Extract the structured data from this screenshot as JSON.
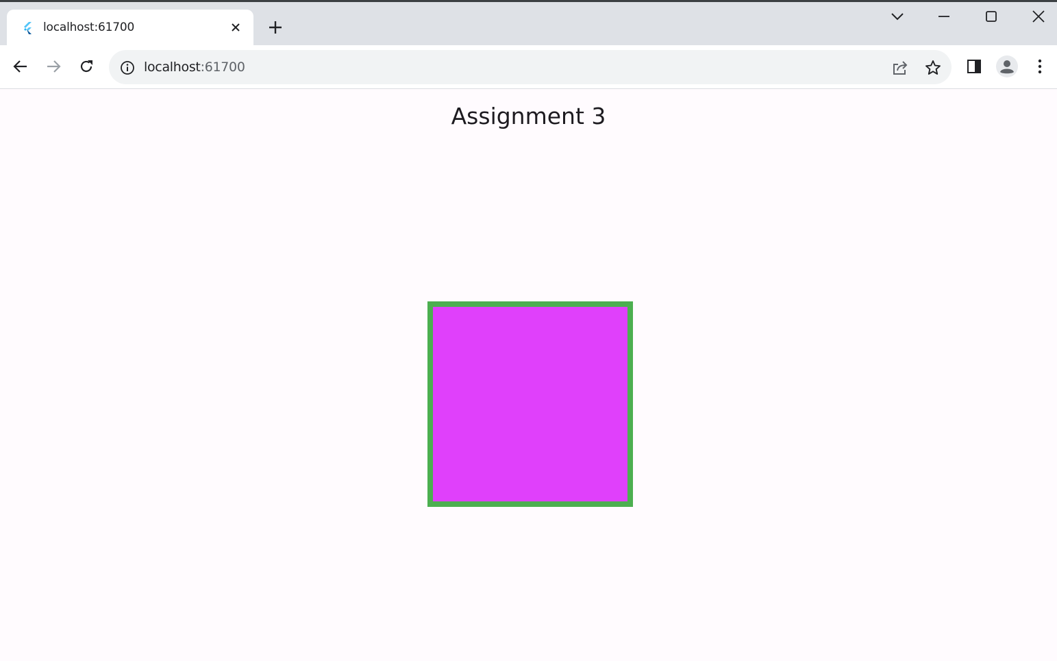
{
  "browser": {
    "tab": {
      "title": "localhost:61700",
      "favicon": "flutter-icon"
    },
    "new_tab_icon": "plus-icon",
    "window_controls": [
      "tab-search-icon",
      "minimize-icon",
      "maximize-icon",
      "close-icon"
    ],
    "address_bar": {
      "host": "localhost",
      "port": ":61700",
      "site_info_icon": "info-icon"
    },
    "toolbar_icons": [
      "back-icon",
      "forward-icon",
      "reload-icon",
      "share-icon",
      "star-icon",
      "side-panel-icon",
      "profile-icon",
      "menu-icon"
    ]
  },
  "app": {
    "title": "Assignment 3",
    "background_color": "#fffbfe",
    "box": {
      "fill_color": "#e040fb",
      "border_color": "#4caf50"
    }
  }
}
